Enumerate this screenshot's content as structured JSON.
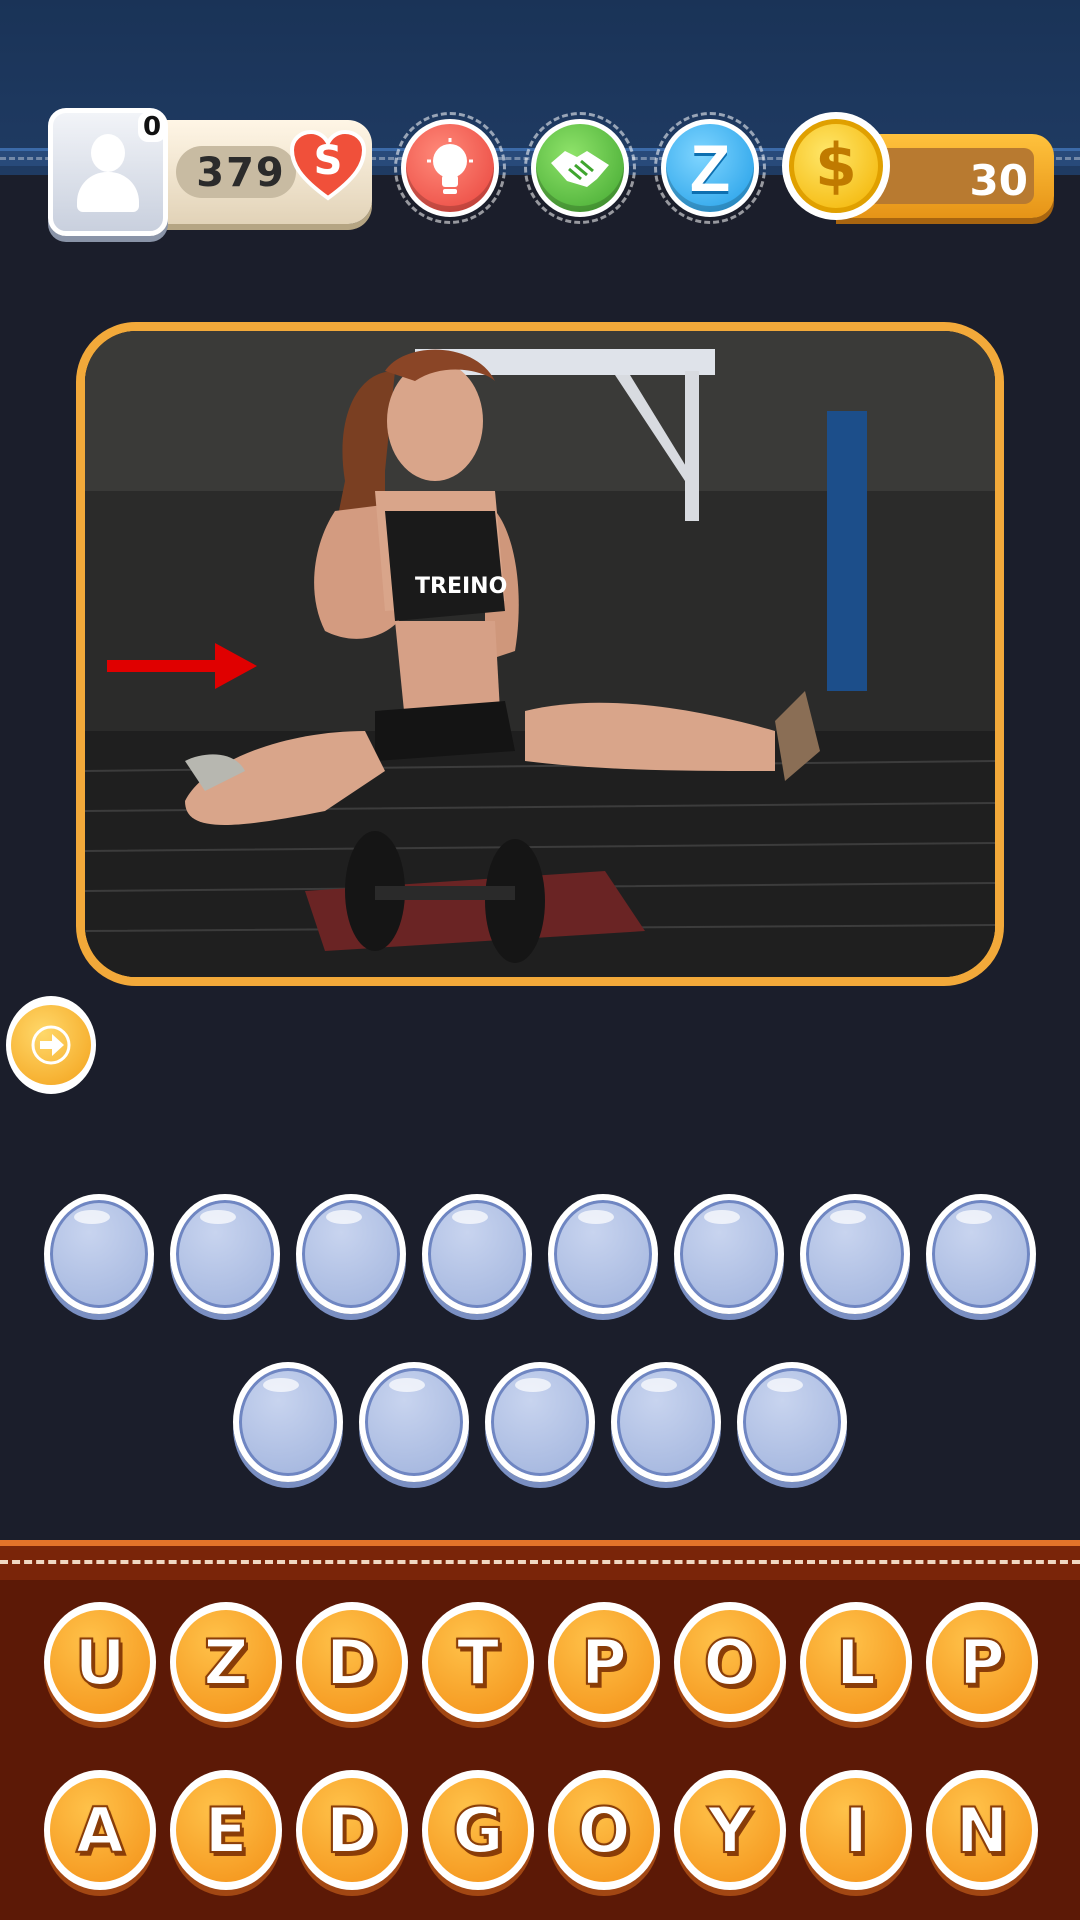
{
  "header": {
    "profile_count": "0",
    "lives": "379",
    "heart_label": "S",
    "coins": "30",
    "powerups": [
      {
        "name": "hint",
        "icon": "lightbulb-icon",
        "color": "#e8413a"
      },
      {
        "name": "help",
        "icon": "handshake-icon",
        "color": "#3fa52e"
      },
      {
        "name": "z",
        "icon": "z-letter-icon",
        "label": "Z",
        "color": "#1c9be6"
      }
    ],
    "coin_icon_label": "$"
  },
  "puzzle": {
    "image": "gym-athlete-photo",
    "annotation": "red-arrow-icon",
    "answer_slots_row1": 8,
    "answer_slots_row2": 5
  },
  "keyboard": {
    "row1": [
      "U",
      "Z",
      "D",
      "T",
      "P",
      "O",
      "L",
      "P"
    ],
    "row2": [
      "A",
      "E",
      "D",
      "G",
      "O",
      "Y",
      "I",
      "N"
    ]
  },
  "colors": {
    "background": "#1b1e2b",
    "frame": "#f2a93a",
    "keyboard_panel": "#5c1906",
    "key": "#f39017",
    "slot": "#9fb2dc"
  }
}
